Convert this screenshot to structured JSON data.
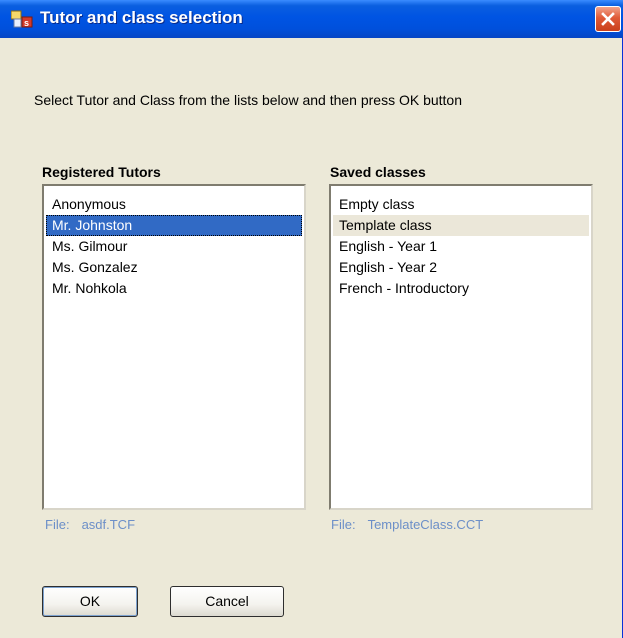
{
  "window": {
    "title": "Tutor and class selection",
    "app_icon": "app-icon",
    "close_icon": "close-icon"
  },
  "instruction": "Select Tutor and Class from the lists below and then press OK button",
  "tutors": {
    "heading": "Registered Tutors",
    "items": [
      "Anonymous",
      "Mr. Johnston",
      "Ms. Gilmour",
      "Ms. Gonzalez",
      "Mr. Nohkola"
    ],
    "selected": "Mr. Johnston",
    "file_label": "File:",
    "file_name": "asdf.TCF"
  },
  "classes": {
    "heading": "Saved classes",
    "items": [
      "Empty class",
      "Template class",
      "English - Year 1",
      "English - Year 2",
      "French - Introductory"
    ],
    "hovered": "Template class",
    "file_label": "File:",
    "file_name": "TemplateClass.CCT"
  },
  "buttons": {
    "ok_label": "OK",
    "cancel_label": "Cancel"
  },
  "colors": {
    "selection": "#316ac5",
    "titlebar": "#0054e3",
    "file_text": "#6c8fc8"
  }
}
